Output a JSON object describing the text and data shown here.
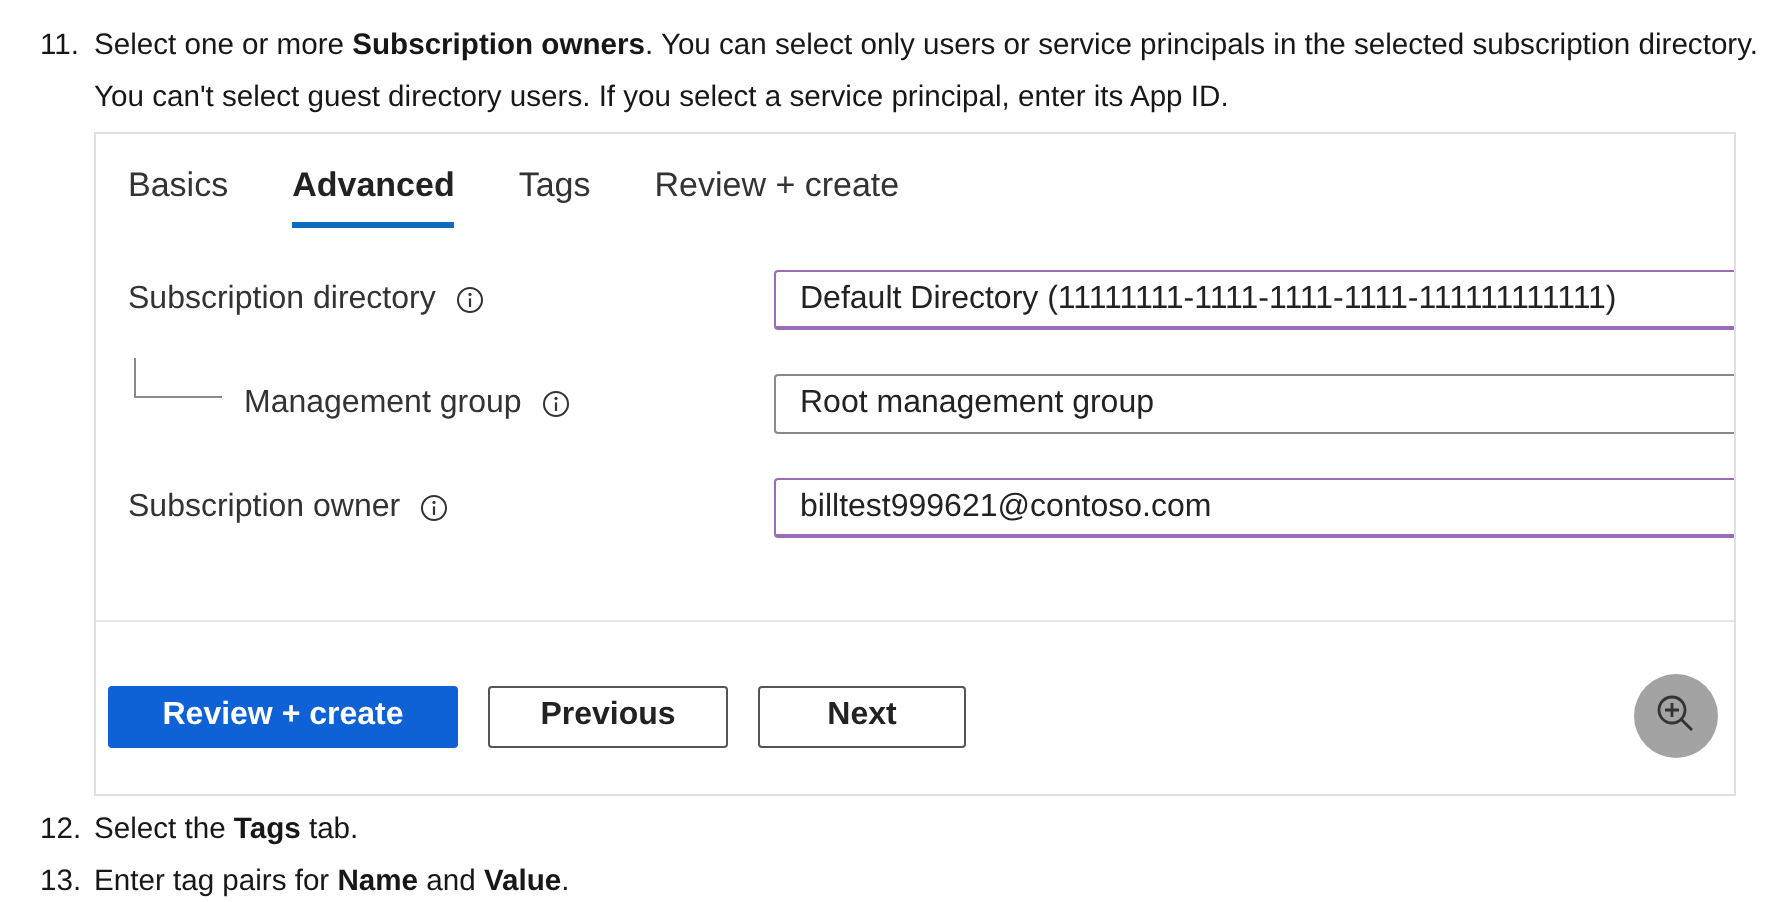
{
  "step": {
    "number": "11.",
    "text": "Select one or more **Subscription owners**. You can select only users or service principals in the selected subscription directory. You can't select guest directory users. If you select a service principal, enter its App ID."
  },
  "screenshot": {
    "tabs": [
      {
        "label": "Basics",
        "selected": false
      },
      {
        "label": "Advanced",
        "selected": true
      },
      {
        "label": "Tags",
        "selected": false
      },
      {
        "label": "Review + create",
        "selected": false
      }
    ],
    "fields": [
      {
        "label": "Subscription directory",
        "value": "Default Directory (11111111-1111-1111-1111-111111111111)",
        "highlighted": true,
        "children": [
          {
            "label": "Management group",
            "value": "Root management group",
            "highlighted": false
          }
        ]
      },
      {
        "label": "Subscription owner",
        "value": "billtest999621@contoso.com",
        "highlighted": true
      }
    ],
    "buttons": [
      {
        "label": "Review + create",
        "kind": "primary"
      },
      {
        "label": "Previous",
        "kind": "secondary"
      },
      {
        "label": "Next",
        "kind": "secondary"
      }
    ]
  },
  "next_steps": [
    {
      "number": "12.",
      "text": "Select the **Tags** tab."
    },
    {
      "number": "13.",
      "text": "Enter tag pairs for **Name** and **Value**."
    }
  ]
}
